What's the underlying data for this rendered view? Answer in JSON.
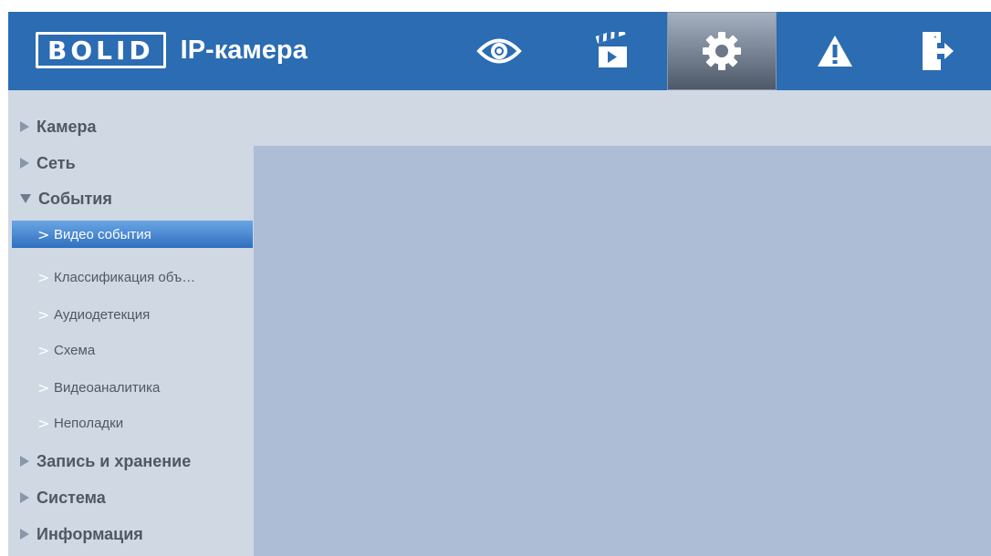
{
  "header": {
    "logo_text": "BOLID",
    "title": "IP-камера",
    "nav": [
      {
        "name": "live-view",
        "icon": "eye-icon"
      },
      {
        "name": "playback",
        "icon": "clapperboard-icon"
      },
      {
        "name": "settings",
        "icon": "gear-icon",
        "active": true
      },
      {
        "name": "alarm",
        "icon": "warning-icon"
      },
      {
        "name": "logout",
        "icon": "exit-door-icon"
      }
    ]
  },
  "sidebar": {
    "items": [
      {
        "label": "Камера",
        "expanded": false
      },
      {
        "label": "Сеть",
        "expanded": false
      },
      {
        "label": "События",
        "expanded": true
      },
      {
        "label": "Запись и хранение",
        "expanded": false
      },
      {
        "label": "Система",
        "expanded": false
      },
      {
        "label": "Информация",
        "expanded": false
      }
    ],
    "subitems": [
      {
        "label": "Видео события",
        "selected": true
      },
      {
        "label": "Классификация объ…"
      },
      {
        "label": "Аудиодетекция"
      },
      {
        "label": "Схема"
      },
      {
        "label": "Видеоаналитика"
      },
      {
        "label": "Неполадки"
      }
    ]
  },
  "colors": {
    "header": "#2b6cb3",
    "sidebar": "#cfd8e3",
    "content": "#aebdd6",
    "selected": "#2f6fc0"
  }
}
